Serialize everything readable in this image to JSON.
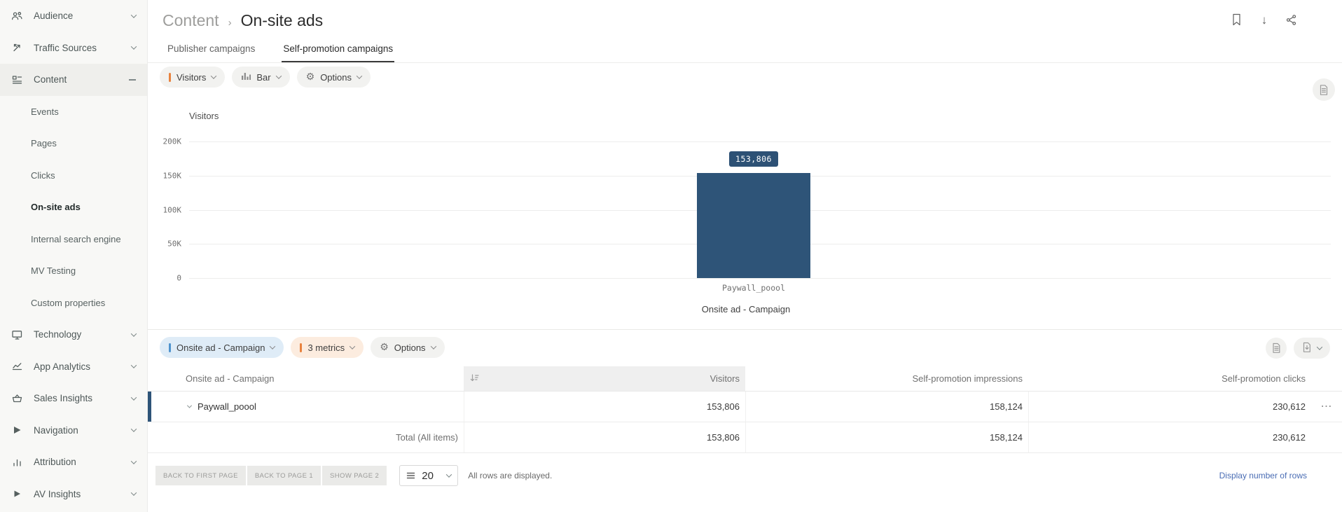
{
  "sidebar": {
    "items": [
      {
        "label": "Audience"
      },
      {
        "label": "Traffic Sources"
      },
      {
        "label": "Content"
      },
      {
        "label": "Events"
      },
      {
        "label": "Pages"
      },
      {
        "label": "Clicks"
      },
      {
        "label": "On-site ads"
      },
      {
        "label": "Internal search engine"
      },
      {
        "label": "MV Testing"
      },
      {
        "label": "Custom properties"
      },
      {
        "label": "Technology"
      },
      {
        "label": "App Analytics"
      },
      {
        "label": "Sales Insights"
      },
      {
        "label": "Navigation"
      },
      {
        "label": "Attribution"
      },
      {
        "label": "AV Insights"
      }
    ]
  },
  "header": {
    "breadcrumb_parent": "Content",
    "breadcrumb_separator": "›",
    "title": "On-site ads"
  },
  "tabs": [
    {
      "label": "Publisher campaigns",
      "active": false
    },
    {
      "label": "Self-promotion campaigns",
      "active": true
    }
  ],
  "chart_controls": {
    "metric_label": "Visitors",
    "chart_type_label": "Bar",
    "options_label": "Options"
  },
  "chart_data": {
    "type": "bar",
    "title": "Visitors",
    "categories": [
      "Paywall_poool"
    ],
    "values": [
      153806
    ],
    "value_labels": [
      "153,806"
    ],
    "xlabel": "Onsite ad - Campaign",
    "ylabel": "Visitors",
    "ylim": [
      0,
      200000
    ],
    "ytick_values": [
      200000,
      150000,
      100000,
      50000,
      0
    ],
    "ytick_labels": [
      "200K",
      "150K",
      "100K",
      "50K",
      "0"
    ],
    "grid": true,
    "legend": "none",
    "bar_color": "#2e5478"
  },
  "table_controls": {
    "dimension_label": "Onsite ad - Campaign",
    "metrics_label": "3 metrics",
    "options_label": "Options"
  },
  "table": {
    "columns": [
      "Onsite ad - Campaign",
      "Visitors",
      "Self-promotion impressions",
      "Self-promotion clicks"
    ],
    "rows": [
      {
        "label": "Paywall_poool",
        "visitors": "153,806",
        "impressions": "158,124",
        "clicks": "230,612"
      }
    ],
    "total": {
      "label": "Total (All items)",
      "visitors": "153,806",
      "impressions": "158,124",
      "clicks": "230,612"
    }
  },
  "pagination": {
    "back_to_first_label": "BACK TO FIRST PAGE",
    "back_to_page_label": "BACK TO PAGE 1",
    "show_page_label": "SHOW PAGE 2",
    "rows_per_page": "20",
    "status": "All rows are displayed.",
    "display_rows_link": "Display number of rows"
  },
  "icons": {
    "kebab": "⋯",
    "gear": "⚙",
    "download_arrow": "↓"
  },
  "colors": {
    "bar": "#2e5478",
    "accent_orange": "#e8823e",
    "accent_blue": "#4f93ce",
    "link_blue": "#4a6db4",
    "active_indicator": "#2e5478",
    "sorted_header_bg": "#efefef"
  }
}
